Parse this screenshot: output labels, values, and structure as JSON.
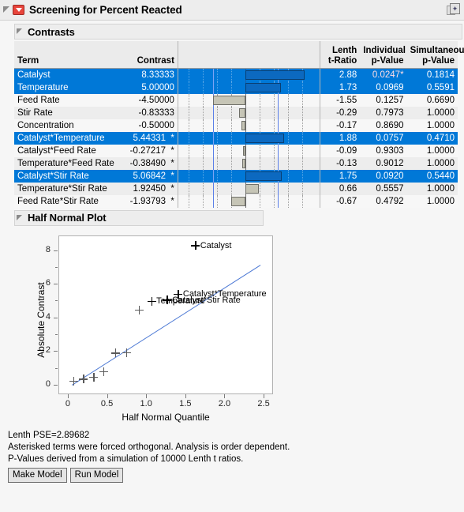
{
  "window": {
    "title": "Screening for Percent Reacted",
    "menu_icon": "red-triangle-menu-icon",
    "window_control_icon": "restore-window-icon"
  },
  "sections": {
    "contrasts_title": "Contrasts",
    "half_normal_title": "Half Normal Plot"
  },
  "contrasts_table": {
    "columns": {
      "term": "Term",
      "contrast": "Contrast",
      "lenth_t_ratio": "Lenth\nt-Ratio",
      "individual_p": "Individual\np-Value",
      "simultaneous_p": "Simultaneous\np-Value"
    },
    "rows": [
      {
        "term": "Catalyst",
        "contrast": "8.33333",
        "star": "",
        "t": "2.88",
        "p_ind": "0.0247*",
        "p_sim": "0.1814",
        "selected": true,
        "sig": true,
        "value": 8.33333
      },
      {
        "term": "Temperature",
        "contrast": "5.00000",
        "star": "",
        "t": "1.73",
        "p_ind": "0.0969",
        "p_sim": "0.5591",
        "selected": true,
        "sig": false,
        "value": 5.0
      },
      {
        "term": "Feed Rate",
        "contrast": "-4.50000",
        "star": "",
        "t": "-1.55",
        "p_ind": "0.1257",
        "p_sim": "0.6690",
        "selected": false,
        "sig": false,
        "value": -4.5
      },
      {
        "term": "Stir Rate",
        "contrast": "-0.83333",
        "star": "",
        "t": "-0.29",
        "p_ind": "0.7973",
        "p_sim": "1.0000",
        "selected": false,
        "sig": false,
        "value": -0.83333
      },
      {
        "term": "Concentration",
        "contrast": "-0.50000",
        "star": "",
        "t": "-0.17",
        "p_ind": "0.8690",
        "p_sim": "1.0000",
        "selected": false,
        "sig": false,
        "value": -0.5
      },
      {
        "term": "Catalyst*Temperature",
        "contrast": "5.44331",
        "star": "*",
        "t": "1.88",
        "p_ind": "0.0757",
        "p_sim": "0.4710",
        "selected": true,
        "sig": false,
        "value": 5.44331
      },
      {
        "term": "Catalyst*Feed Rate",
        "contrast": "-0.27217",
        "star": "*",
        "t": "-0.09",
        "p_ind": "0.9303",
        "p_sim": "1.0000",
        "selected": false,
        "sig": false,
        "value": -0.27217
      },
      {
        "term": "Temperature*Feed Rate",
        "contrast": "-0.38490",
        "star": "*",
        "t": "-0.13",
        "p_ind": "0.9012",
        "p_sim": "1.0000",
        "selected": false,
        "sig": false,
        "value": -0.3849
      },
      {
        "term": "Catalyst*Stir Rate",
        "contrast": "5.06842",
        "star": "*",
        "t": "1.75",
        "p_ind": "0.0920",
        "p_sim": "0.5440",
        "selected": true,
        "sig": false,
        "value": 5.06842
      },
      {
        "term": "Temperature*Stir Rate",
        "contrast": "1.92450",
        "star": "*",
        "t": "0.66",
        "p_ind": "0.5557",
        "p_sim": "1.0000",
        "selected": false,
        "sig": false,
        "value": 1.9245
      },
      {
        "term": "Feed Rate*Stir Rate",
        "contrast": "-1.93793",
        "star": "*",
        "t": "-0.67",
        "p_ind": "0.4792",
        "p_sim": "1.0000",
        "selected": false,
        "sig": false,
        "value": -1.93793
      }
    ]
  },
  "chart_data": {
    "type": "scatter",
    "title": "Half Normal Plot",
    "xlabel": "Half Normal Quantile",
    "ylabel": "Absolute Contrast",
    "xlim": [
      -0.12,
      2.62
    ],
    "ylim": [
      -0.55,
      8.9
    ],
    "xticks": [
      "0",
      "0.5",
      "1.0",
      "1.5",
      "2.0",
      "2.5"
    ],
    "xtick_values": [
      0,
      0.5,
      1.0,
      1.5,
      2.0,
      2.5
    ],
    "yticks": [
      "0",
      "2",
      "4",
      "6",
      "8"
    ],
    "ytick_values": [
      0,
      2,
      4,
      6,
      8
    ],
    "grid": false,
    "legend": "none",
    "fit_line": {
      "x0": 0.04,
      "y0": 0.05,
      "x1": 2.45,
      "y1": 7.2,
      "color": "#4a77d4"
    },
    "points": [
      {
        "x": 0.065,
        "y": 0.27,
        "label": "",
        "labeled": false
      },
      {
        "x": 0.19,
        "y": 0.38,
        "label": "",
        "labeled": false
      },
      {
        "x": 0.32,
        "y": 0.5,
        "label": "",
        "labeled": false
      },
      {
        "x": 0.45,
        "y": 0.83,
        "label": "",
        "labeled": false
      },
      {
        "x": 0.6,
        "y": 1.92,
        "label": "",
        "labeled": false
      },
      {
        "x": 0.74,
        "y": 1.94,
        "label": "",
        "labeled": false
      },
      {
        "x": 0.9,
        "y": 4.5,
        "label": "",
        "labeled": false
      },
      {
        "x": 1.06,
        "y": 5.0,
        "label": "Temperature",
        "labeled": true
      },
      {
        "x": 1.26,
        "y": 5.07,
        "label": "Catalyst*Stir Rate",
        "labeled": true
      },
      {
        "x": 1.4,
        "y": 5.44,
        "label": "Catalyst*Temperature",
        "labeled": true
      },
      {
        "x": 1.62,
        "y": 8.33,
        "label": "Catalyst",
        "labeled": true
      }
    ]
  },
  "footer": {
    "lenth_pse": "Lenth PSE=2.89682",
    "note_orthogonal": "Asterisked terms were forced orthogonal. Analysis is order dependent.",
    "note_pvalues": "P-Values derived from a simulation of 10000 Lenth t ratios.",
    "make_model_label": "Make Model",
    "run_model_label": "Run Model"
  },
  "colors": {
    "selection_blue": "#0078d7",
    "significant_red": "#d81e3f",
    "fit_line_blue": "#4a77d4",
    "bar_gray": "#c6c5b6",
    "bar_blue": "#0c69c0"
  }
}
